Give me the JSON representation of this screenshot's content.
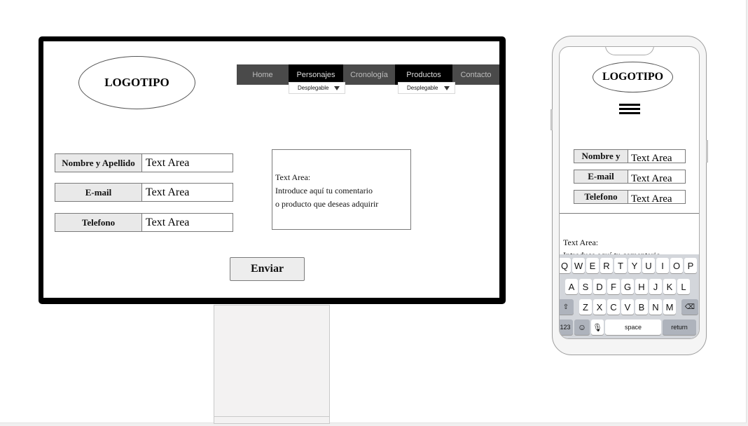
{
  "desktop": {
    "logo": "LOGOTIPO",
    "nav": [
      {
        "label": "Home"
      },
      {
        "label": "Personajes"
      },
      {
        "label": "Cronología"
      },
      {
        "label": "Productos"
      },
      {
        "label": "Contacto"
      }
    ],
    "dropdowns": [
      {
        "label": "Desplegable"
      },
      {
        "label": "Desplegable"
      }
    ],
    "form": {
      "fields": [
        {
          "label": "Nombre y Apellido",
          "value": "Text Area"
        },
        {
          "label": "E-mail",
          "value": "Text Area"
        },
        {
          "label": "Telefono",
          "value": "Text Area"
        }
      ],
      "comment": {
        "line1": "Text Area:",
        "line2": "Introduce aquí tu comentario",
        "line3": "o producto que deseas adquirir"
      },
      "submit": "Enviar"
    }
  },
  "mobile": {
    "logo": "LOGOTIPO",
    "menu_icon": "hamburger-menu-icon",
    "fields": [
      {
        "label": "Nombre y",
        "value": "Text Area"
      },
      {
        "label": "E-mail",
        "value": "Text Area"
      },
      {
        "label": "Telefono",
        "value": "Text Area"
      }
    ],
    "comment": {
      "line1": "Text Area:",
      "line2": "Introduce aquí tu comentario"
    },
    "keyboard": {
      "row1": [
        "Q",
        "W",
        "E",
        "R",
        "T",
        "Y",
        "U",
        "I",
        "O",
        "P"
      ],
      "row2": [
        "A",
        "S",
        "D",
        "F",
        "G",
        "H",
        "J",
        "K",
        "L"
      ],
      "row3": [
        "Z",
        "X",
        "C",
        "V",
        "B",
        "N",
        "M"
      ],
      "num": "123",
      "space": "space",
      "return": "return"
    }
  }
}
